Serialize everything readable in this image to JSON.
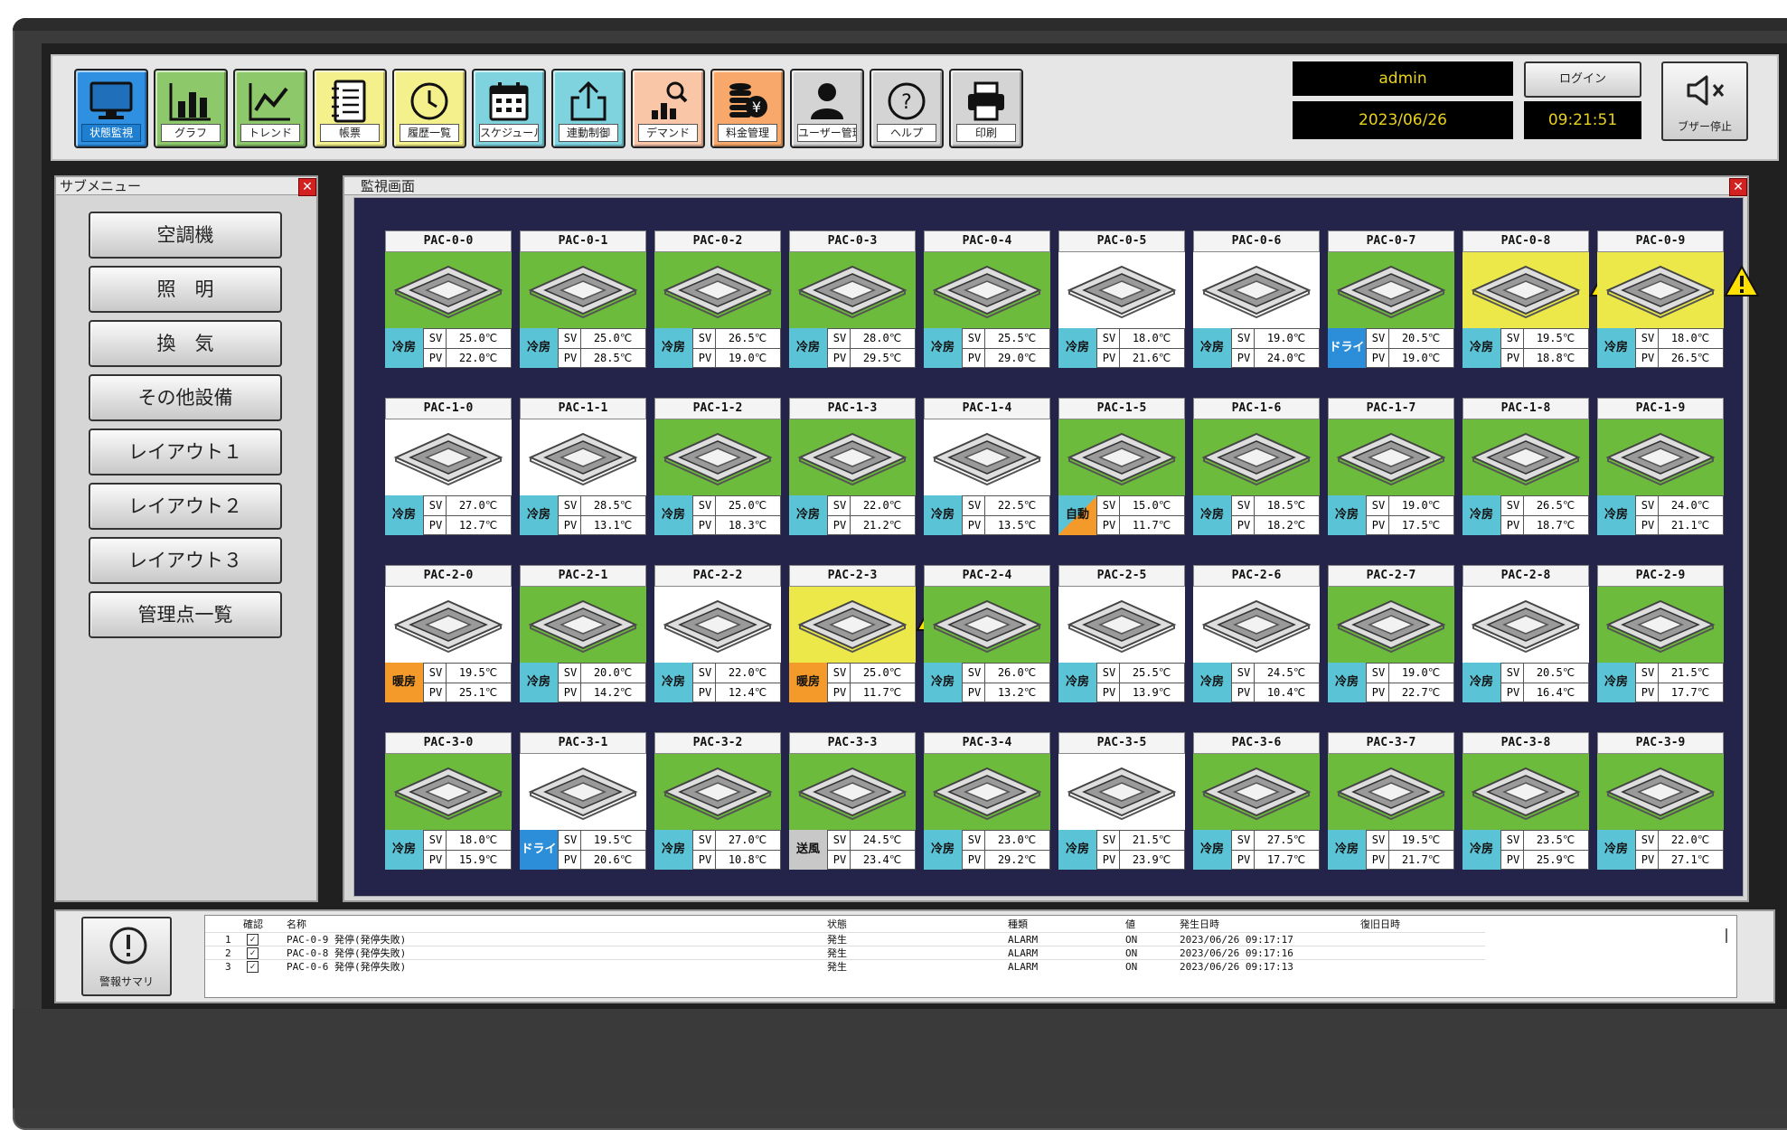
{
  "toolbar": {
    "buttons": [
      {
        "label": "状態監視",
        "icon": "monitor-icon",
        "color": "#2f8fe0",
        "active": true
      },
      {
        "label": "グラフ",
        "icon": "bar-chart-icon",
        "color": "#8dc86a"
      },
      {
        "label": "トレンド",
        "icon": "trend-line-icon",
        "color": "#8dc86a"
      },
      {
        "label": "帳票",
        "icon": "notebook-icon",
        "color": "#f4f08c"
      },
      {
        "label": "履歴一覧",
        "icon": "history-clock-icon",
        "color": "#f4f08c"
      },
      {
        "label": "スケジュール",
        "icon": "calendar-icon",
        "color": "#7fd3df"
      },
      {
        "label": "連動制御",
        "icon": "share-export-icon",
        "color": "#7fd3df"
      },
      {
        "label": "デマンド",
        "icon": "demand-chart-icon",
        "color": "#f9c6a8"
      },
      {
        "label": "料金管理",
        "icon": "coins-yen-icon",
        "color": "#f7a86a"
      },
      {
        "label": "ユーザー管理",
        "icon": "user-icon",
        "color": "#d4d4d4"
      },
      {
        "label": "ヘルプ",
        "icon": "help-icon",
        "color": "#d4d4d4"
      },
      {
        "label": "印刷",
        "icon": "printer-icon",
        "color": "#d4d4d4"
      }
    ],
    "user": "admin",
    "date": "2023/06/26",
    "login_label": "ログイン",
    "time": "09:21:51",
    "buzzer_label": "ブザー停止"
  },
  "submenu": {
    "title": "サブメニュー",
    "items": [
      "空調機",
      "照　明",
      "換　気",
      "その他設備",
      "レイアウト１",
      "レイアウト２",
      "レイアウト３",
      "管理点一覧"
    ]
  },
  "monitor": {
    "title": "監視画面",
    "colors": {
      "run": "#6cbb3c",
      "stop": "#ffffff",
      "alarm": "#ece84a",
      "cool": "#5bc3d6",
      "dry": "#2c8ed9",
      "heat": "#f39a2b",
      "fan": "#c8c8c8"
    },
    "units": [
      {
        "name": "PAC-0-0",
        "state": "run",
        "mode": "冷房",
        "mode_color": "cool",
        "sv": "25.0℃",
        "pv": "22.0℃"
      },
      {
        "name": "PAC-0-1",
        "state": "run",
        "mode": "冷房",
        "mode_color": "cool",
        "sv": "25.0℃",
        "pv": "28.5℃"
      },
      {
        "name": "PAC-0-2",
        "state": "run",
        "mode": "冷房",
        "mode_color": "cool",
        "sv": "26.5℃",
        "pv": "19.0℃"
      },
      {
        "name": "PAC-0-3",
        "state": "run",
        "mode": "冷房",
        "mode_color": "cool",
        "sv": "28.0℃",
        "pv": "29.5℃"
      },
      {
        "name": "PAC-0-4",
        "state": "run",
        "mode": "冷房",
        "mode_color": "cool",
        "sv": "25.5℃",
        "pv": "29.0℃"
      },
      {
        "name": "PAC-0-5",
        "state": "stop",
        "mode": "冷房",
        "mode_color": "cool",
        "sv": "18.0℃",
        "pv": "21.6℃"
      },
      {
        "name": "PAC-0-6",
        "state": "stop",
        "mode": "冷房",
        "mode_color": "cool",
        "sv": "19.0℃",
        "pv": "24.0℃"
      },
      {
        "name": "PAC-0-7",
        "state": "run",
        "mode": "ドライ",
        "mode_color": "dry",
        "sv": "20.5℃",
        "pv": "19.0℃"
      },
      {
        "name": "PAC-0-8",
        "state": "alarm",
        "mode": "冷房",
        "mode_color": "cool",
        "sv": "19.5℃",
        "pv": "18.8℃"
      },
      {
        "name": "PAC-0-9",
        "state": "alarm",
        "mode": "冷房",
        "mode_color": "cool",
        "sv": "18.0℃",
        "pv": "26.5℃"
      },
      {
        "name": "PAC-1-0",
        "state": "stop",
        "mode": "冷房",
        "mode_color": "cool",
        "sv": "27.0℃",
        "pv": "12.7℃"
      },
      {
        "name": "PAC-1-1",
        "state": "stop",
        "mode": "冷房",
        "mode_color": "cool",
        "sv": "28.5℃",
        "pv": "13.1℃"
      },
      {
        "name": "PAC-1-2",
        "state": "run",
        "mode": "冷房",
        "mode_color": "cool",
        "sv": "25.0℃",
        "pv": "18.3℃"
      },
      {
        "name": "PAC-1-3",
        "state": "run",
        "mode": "冷房",
        "mode_color": "cool",
        "sv": "22.0℃",
        "pv": "21.2℃"
      },
      {
        "name": "PAC-1-4",
        "state": "stop",
        "mode": "冷房",
        "mode_color": "cool",
        "sv": "22.5℃",
        "pv": "13.5℃"
      },
      {
        "name": "PAC-1-5",
        "state": "run",
        "mode": "自動",
        "mode_color": "auto",
        "sv": "15.0℃",
        "pv": "11.7℃"
      },
      {
        "name": "PAC-1-6",
        "state": "run",
        "mode": "冷房",
        "mode_color": "cool",
        "sv": "18.5℃",
        "pv": "18.2℃"
      },
      {
        "name": "PAC-1-7",
        "state": "run",
        "mode": "冷房",
        "mode_color": "cool",
        "sv": "19.0℃",
        "pv": "17.5℃"
      },
      {
        "name": "PAC-1-8",
        "state": "run",
        "mode": "冷房",
        "mode_color": "cool",
        "sv": "26.5℃",
        "pv": "18.7℃"
      },
      {
        "name": "PAC-1-9",
        "state": "run",
        "mode": "冷房",
        "mode_color": "cool",
        "sv": "24.0℃",
        "pv": "21.1℃"
      },
      {
        "name": "PAC-2-0",
        "state": "stop",
        "mode": "暖房",
        "mode_color": "heat",
        "sv": "19.5℃",
        "pv": "25.1℃"
      },
      {
        "name": "PAC-2-1",
        "state": "run",
        "mode": "冷房",
        "mode_color": "cool",
        "sv": "20.0℃",
        "pv": "14.2℃"
      },
      {
        "name": "PAC-2-2",
        "state": "stop",
        "mode": "冷房",
        "mode_color": "cool",
        "sv": "22.0℃",
        "pv": "12.4℃"
      },
      {
        "name": "PAC-2-3",
        "state": "alarm",
        "mode": "暖房",
        "mode_color": "heat",
        "sv": "25.0℃",
        "pv": "11.7℃"
      },
      {
        "name": "PAC-2-4",
        "state": "run",
        "mode": "冷房",
        "mode_color": "cool",
        "sv": "26.0℃",
        "pv": "13.2℃"
      },
      {
        "name": "PAC-2-5",
        "state": "stop",
        "mode": "冷房",
        "mode_color": "cool",
        "sv": "25.5℃",
        "pv": "13.9℃"
      },
      {
        "name": "PAC-2-6",
        "state": "stop",
        "mode": "冷房",
        "mode_color": "cool",
        "sv": "24.5℃",
        "pv": "10.4℃"
      },
      {
        "name": "PAC-2-7",
        "state": "run",
        "mode": "冷房",
        "mode_color": "cool",
        "sv": "19.0℃",
        "pv": "22.7℃"
      },
      {
        "name": "PAC-2-8",
        "state": "stop",
        "mode": "冷房",
        "mode_color": "cool",
        "sv": "20.5℃",
        "pv": "16.4℃"
      },
      {
        "name": "PAC-2-9",
        "state": "run",
        "mode": "冷房",
        "mode_color": "cool",
        "sv": "21.5℃",
        "pv": "17.7℃"
      },
      {
        "name": "PAC-3-0",
        "state": "run",
        "mode": "冷房",
        "mode_color": "cool",
        "sv": "18.0℃",
        "pv": "15.9℃"
      },
      {
        "name": "PAC-3-1",
        "state": "stop",
        "mode": "ドライ",
        "mode_color": "dry",
        "sv": "19.5℃",
        "pv": "20.6℃"
      },
      {
        "name": "PAC-3-2",
        "state": "run",
        "mode": "冷房",
        "mode_color": "cool",
        "sv": "27.0℃",
        "pv": "10.8℃"
      },
      {
        "name": "PAC-3-3",
        "state": "run",
        "mode": "送風",
        "mode_color": "fan",
        "sv": "24.5℃",
        "pv": "23.4℃"
      },
      {
        "name": "PAC-3-4",
        "state": "run",
        "mode": "冷房",
        "mode_color": "cool",
        "sv": "23.0℃",
        "pv": "29.2℃"
      },
      {
        "name": "PAC-3-5",
        "state": "stop",
        "mode": "冷房",
        "mode_color": "cool",
        "sv": "21.5℃",
        "pv": "23.9℃"
      },
      {
        "name": "PAC-3-6",
        "state": "run",
        "mode": "冷房",
        "mode_color": "cool",
        "sv": "27.5℃",
        "pv": "17.7℃"
      },
      {
        "name": "PAC-3-7",
        "state": "run",
        "mode": "冷房",
        "mode_color": "cool",
        "sv": "19.5℃",
        "pv": "21.7℃"
      },
      {
        "name": "PAC-3-8",
        "state": "run",
        "mode": "冷房",
        "mode_color": "cool",
        "sv": "23.5℃",
        "pv": "25.9℃"
      },
      {
        "name": "PAC-3-9",
        "state": "run",
        "mode": "冷房",
        "mode_color": "cool",
        "sv": "22.0℃",
        "pv": "27.1℃"
      }
    ]
  },
  "alarm_summary": {
    "button_label": "警報サマリ",
    "headers": {
      "check": "確認",
      "name": "名称",
      "status": "状態",
      "type": "種類",
      "value": "値",
      "occurred": "発生日時",
      "recovered": "復旧日時"
    },
    "rows": [
      {
        "no": "1",
        "checked": true,
        "name": "PAC-0-9 発停(発停失敗)",
        "status": "発生",
        "type": "ALARM",
        "value": "ON",
        "occurred": "2023/06/26 09:17:17",
        "recovered": ""
      },
      {
        "no": "2",
        "checked": true,
        "name": "PAC-0-8 発停(発停失敗)",
        "status": "発生",
        "type": "ALARM",
        "value": "ON",
        "occurred": "2023/06/26 09:17:16",
        "recovered": ""
      },
      {
        "no": "3",
        "checked": true,
        "name": "PAC-0-6 発停(発停失敗)",
        "status": "発生",
        "type": "ALARM",
        "value": "ON",
        "occurred": "2023/06/26 09:17:13",
        "recovered": ""
      }
    ]
  }
}
